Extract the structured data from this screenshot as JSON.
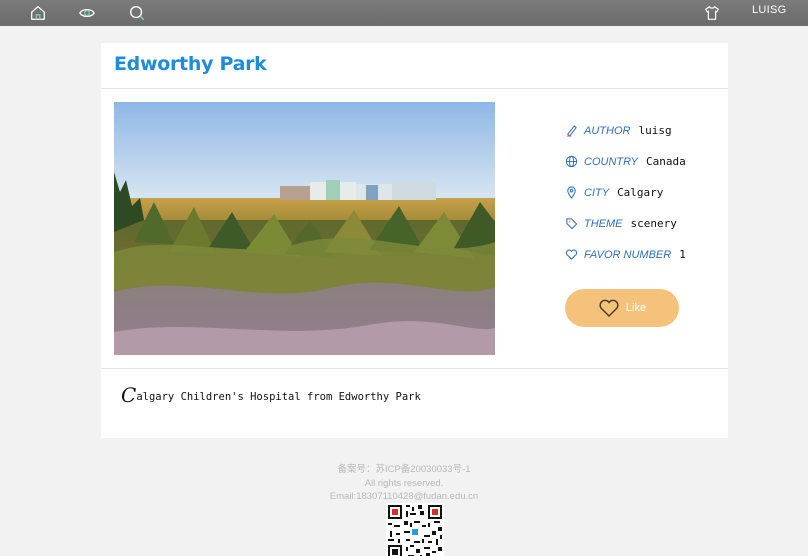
{
  "nav": {
    "icons": [
      "home-icon",
      "eye-icon",
      "search-icon",
      "shirt-icon"
    ],
    "user": "LUISG"
  },
  "post": {
    "title": "Edworthy Park",
    "image_alt": "Calgary Children's Hospital from Edworthy Park",
    "info": [
      {
        "icon": "pen-icon",
        "key": "AUTHOR",
        "value": "luisg"
      },
      {
        "icon": "globe-icon",
        "key": "COUNTRY",
        "value": "Canada"
      },
      {
        "icon": "location-pin-icon",
        "key": "CITY",
        "value": "Calgary"
      },
      {
        "icon": "tag-icon",
        "key": "THEME",
        "value": "scenery"
      },
      {
        "icon": "heart-icon",
        "key": "FAVOR NUMBER",
        "value": "1"
      }
    ],
    "like_label": "Like",
    "description_initial": "C",
    "description_rest": "algary Children's Hospital from Edworthy Park"
  },
  "footer": {
    "icp": "备案号：苏ICP备20030033号-1",
    "rights": "All rights reserved.",
    "email": "Email:18307110428@fudan.edu.cn"
  },
  "colors": {
    "topbar": "#727272",
    "title": "#1e8cd8",
    "info_key": "#2f6fb7",
    "like_button": "#f5c27b",
    "background": "#f2f2f2"
  }
}
